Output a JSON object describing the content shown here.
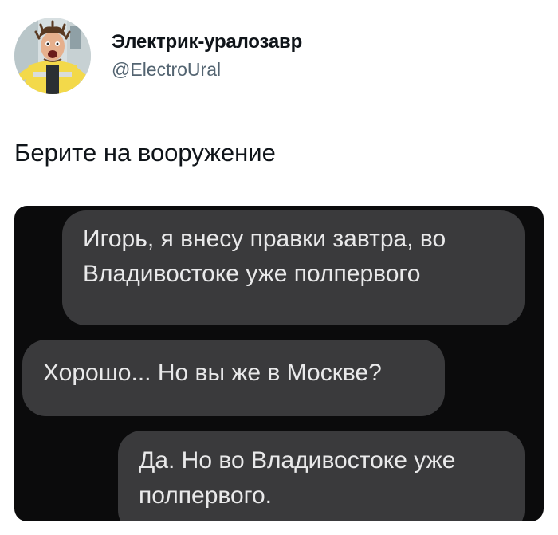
{
  "author": {
    "display_name": "Электрик-уралозавр",
    "handle": "@ElectroUral"
  },
  "tweet": {
    "text": "Берите на вооружение"
  },
  "media": {
    "messages": [
      {
        "side": "right",
        "line1": "Игорь, я внесу правки завтра, во",
        "line2": "Владивостоке уже полпервого"
      },
      {
        "side": "left",
        "line1": "Хорошо... Но вы же в Москве?"
      },
      {
        "side": "right",
        "line1": "Да. Но во Владивостоке уже",
        "line2": "полпервого."
      }
    ]
  },
  "colors": {
    "media_background": "#0b0b0c",
    "bubble": "#3a3a3c",
    "bubble_text": "#e9e9ea",
    "handle_text": "#536471",
    "primary_text": "#0f1419"
  }
}
